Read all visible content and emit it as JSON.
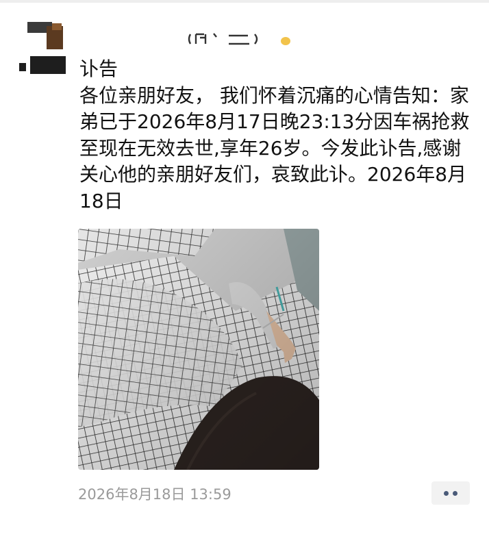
{
  "post": {
    "text": "讣告\n各位亲朋好友， 我们怀着沉痛的心情告知：家弟已于2026年8月17日晚23:13分因车祸抢救至现在无效去世,享年26岁。今发此讣告,感谢关心他的亲朋好友们，哀致此讣。2026年8月18日",
    "timestamp": "2026年8月18日 13:59"
  },
  "icons": {
    "avatar": "avatar-image",
    "more": "more-dots-icon",
    "photo": "hospital-bed-photo"
  },
  "colors": {
    "text": "#111111",
    "timestamp": "#9a9a9a",
    "more_dots": "#4a5a78",
    "more_bg": "#f2f2f2"
  }
}
